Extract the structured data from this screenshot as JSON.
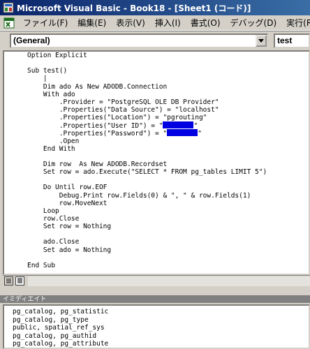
{
  "window": {
    "title": "Microsoft Visual Basic - Book18 - [Sheet1 (コード)]"
  },
  "menu": {
    "items": [
      {
        "label": "ファイル(F)"
      },
      {
        "label": "編集(E)"
      },
      {
        "label": "表示(V)"
      },
      {
        "label": "挿入(I)"
      },
      {
        "label": "書式(O)"
      },
      {
        "label": "デバッグ(D)"
      },
      {
        "label": "実行(R)"
      }
    ]
  },
  "object_combo": {
    "value": "(General)"
  },
  "procedure_combo": {
    "value": "test"
  },
  "code": {
    "lines": [
      "Option Explicit",
      "",
      "Sub test()",
      "    |",
      "    Dim ado As New ADODB.Connection",
      "    With ado",
      "        .Provider = \"PostgreSQL OLE DB Provider\"",
      "        .Properties(\"Data Source\") = \"localhost\"",
      "        .Properties(\"Location\") = \"pgrouting\"",
      "        .Properties(\"User ID\") = \"",
      "        .Properties(\"Password\") = \"",
      "        .Open",
      "    End With",
      "",
      "    Dim row  As New ADODB.Recordset",
      "    Set row = ado.Execute(\"SELECT * FROM pg_tables LIMIT 5\")",
      "",
      "    Do Until row.EOF",
      "        Debug.Print row.Fields(0) & \", \" & row.Fields(1)",
      "        row.MoveNext",
      "    Loop",
      "    row.Close",
      "    Set row = Nothing",
      "",
      "    ado.Close",
      "    Set ado = Nothing",
      "",
      "End Sub"
    ]
  },
  "immediate": {
    "title": "イミディエイト",
    "lines": [
      "pg_catalog, pg_statistic",
      "pg_catalog, pg_type",
      "public, spatial_ref_sys",
      "pg_catalog, pg_authid",
      "pg_catalog, pg_attribute"
    ]
  },
  "colors": {
    "titlebar_start": "#0a246a",
    "titlebar_end": "#3a6ea5",
    "keyword": "#000080",
    "redaction": "#0000e0"
  },
  "icons": [
    "excel-app-icon",
    "excel-view-icon",
    "dropdown-arrow-icon",
    "procedure-view-icon",
    "full-module-view-icon"
  ]
}
